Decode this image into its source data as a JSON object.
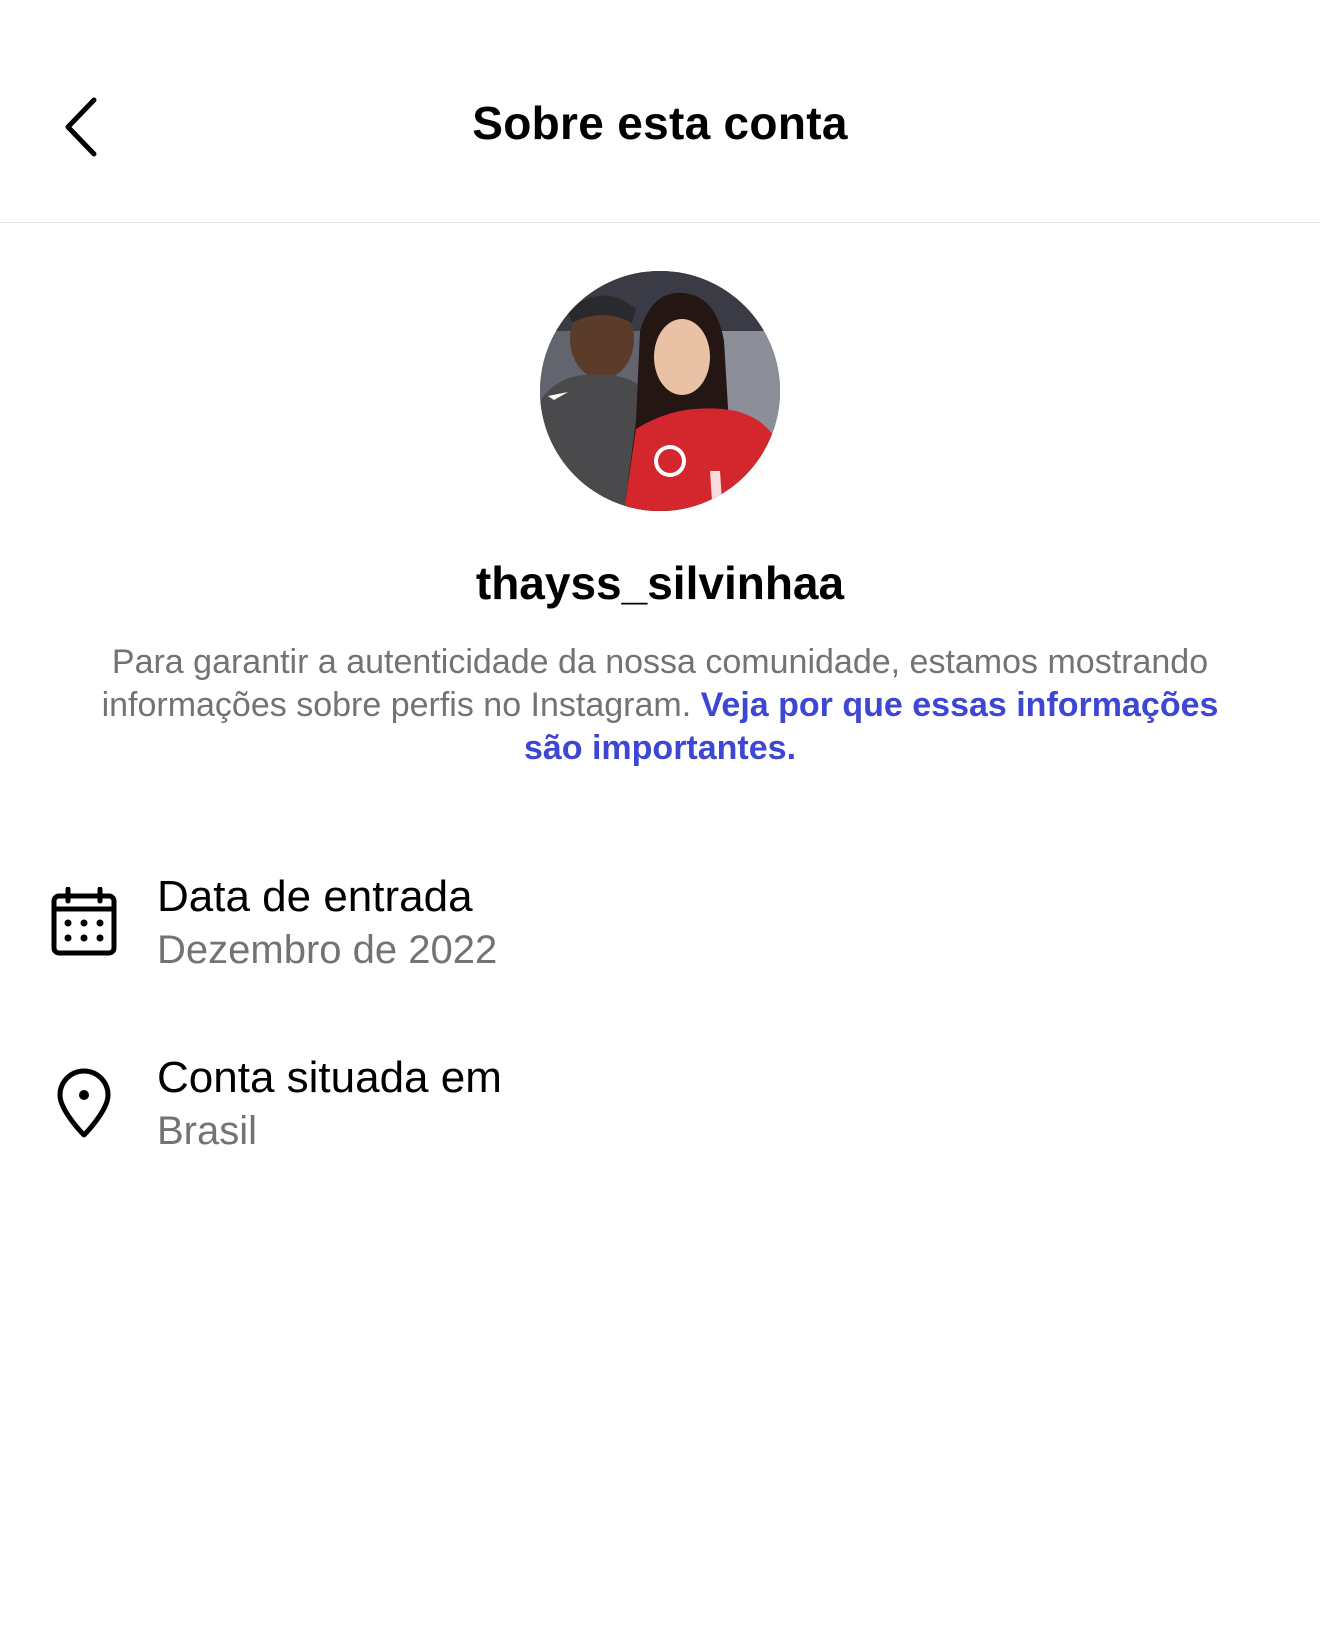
{
  "header": {
    "title": "Sobre esta conta",
    "back_icon": "chevron-left-icon"
  },
  "profile": {
    "avatar_icon": "profile-photo",
    "username": "thayss_silvinhaa",
    "description_text": "Para garantir a autenticidade da nossa comunidade, estamos mostrando informações sobre perfis no Instagram. ",
    "description_link": "Veja por que essas informações são importantes."
  },
  "info": {
    "join_date": {
      "icon": "calendar-icon",
      "label": "Data de entrada",
      "value": "Dezembro de 2022"
    },
    "location": {
      "icon": "location-pin-icon",
      "label": "Conta situada em",
      "value": "Brasil"
    }
  },
  "colors": {
    "link": "#3d47d3",
    "secondary_text": "#737373",
    "divider": "#e6e6e6"
  }
}
